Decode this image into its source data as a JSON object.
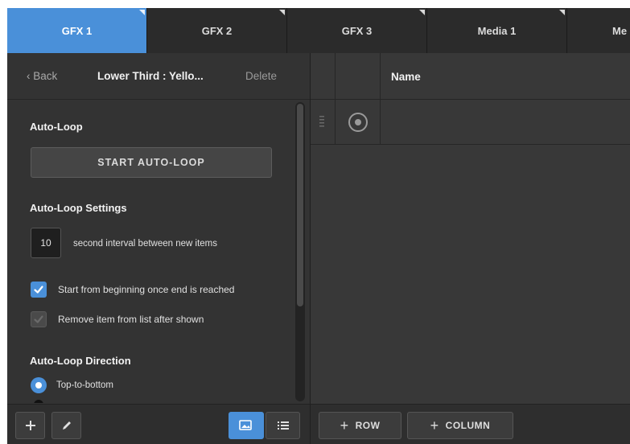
{
  "tabs": [
    {
      "label": "GFX 1",
      "active": true
    },
    {
      "label": "GFX 2",
      "active": false
    },
    {
      "label": "GFX 3",
      "active": false
    },
    {
      "label": "Media 1",
      "active": false
    },
    {
      "label": "Me",
      "active": false
    }
  ],
  "left_panel": {
    "back_label": "Back",
    "back_icon": "chevron-left-icon",
    "title": "Lower Third : Yello...",
    "delete_label": "Delete",
    "auto_loop": {
      "heading": "Auto-Loop",
      "start_button": "START AUTO-LOOP"
    },
    "settings": {
      "heading": "Auto-Loop Settings",
      "interval_value": "10",
      "interval_label": "second interval between new items",
      "start_from_beginning": {
        "label": "Start from beginning once end is reached",
        "checked": true
      },
      "remove_after_shown": {
        "label": "Remove item from list after shown",
        "checked": false
      }
    },
    "direction": {
      "heading": "Auto-Loop Direction",
      "selected_option": "Top-to-bottom"
    },
    "bottom_toolbar": {
      "add_icon": "plus-icon",
      "edit_icon": "pencil-icon",
      "grid_view_icon": "image-view-icon",
      "list_view_icon": "list-view-icon"
    }
  },
  "right_panel": {
    "name_header": "Name",
    "rows": [
      {
        "name": "",
        "drag_icon": "drag-handle-icon"
      }
    ],
    "add_row_label": "ROW",
    "add_column_label": "COLUMN"
  },
  "colors": {
    "accent": "#4a90d9",
    "panel": "#333333",
    "panel_dark": "#2b2b2b"
  }
}
